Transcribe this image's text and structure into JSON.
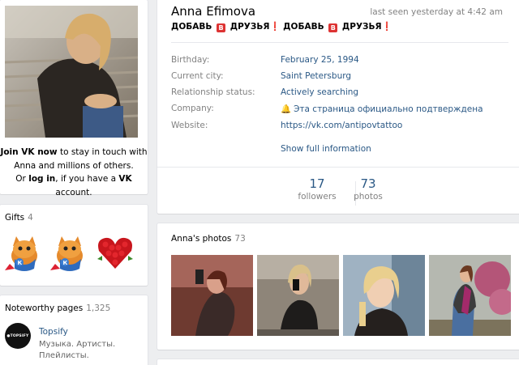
{
  "join": {
    "line1_bold": "Join VK now",
    "line1_rest": " to stay in touch with",
    "line2": "Anna and millions of others.",
    "line3_a": "Or ",
    "line3_login": "log in",
    "line3_b": ", if you have a ",
    "line3_vk": "VK",
    "line3_c": " account."
  },
  "gifts": {
    "title": "Gifts",
    "count": "4"
  },
  "pages": {
    "title": "Noteworthy pages",
    "count": "1,325",
    "item": {
      "logo_text": "●TOPSIFY",
      "name": "Topsify",
      "desc": "Музыка. Артисты. Плейлисты."
    }
  },
  "profile": {
    "name": "Anna Efimova",
    "last_seen": "last seen yesterday at 4:42 am",
    "status": {
      "part1": "ДОБАВЬ",
      "badge": "В",
      "part2": "ДРУЗЬЯ",
      "excl": "❗"
    }
  },
  "info": {
    "rows": [
      {
        "label": "Birthday:",
        "value": "February 25, 1994"
      },
      {
        "label": "Current city:",
        "value": "Saint Petersburg"
      },
      {
        "label": "Relationship status:",
        "value": "Actively searching"
      },
      {
        "label": "Company:",
        "value": "Эта страница официально подтверждена"
      },
      {
        "label": "Website:",
        "value": "https://vk.com/antipovtattoo"
      }
    ],
    "show_full": "Show full information"
  },
  "counters": [
    {
      "num": "17",
      "label": "followers"
    },
    {
      "num": "73",
      "label": "photos"
    }
  ],
  "photos": {
    "title": "Anna's photos",
    "count": "73"
  },
  "colors": {
    "link": "#2a5885",
    "muted": "#828282",
    "bg": "#edeef0",
    "badge": "#d33333"
  }
}
